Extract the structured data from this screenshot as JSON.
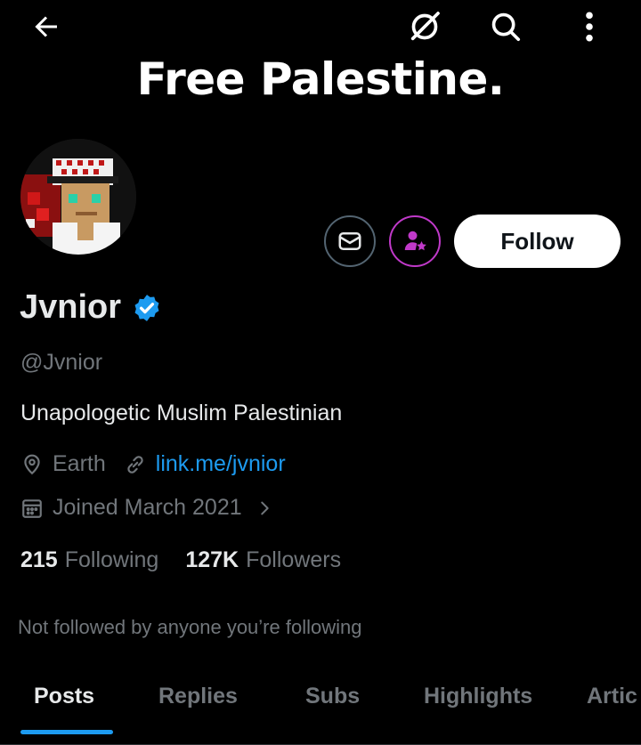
{
  "banner": {
    "text": "Free Palestine."
  },
  "actions": {
    "follow_label": "Follow"
  },
  "profile": {
    "name": "Jvnior",
    "handle": "@Jvnior",
    "bio": "Unapologetic Muslim Palestinian",
    "location": "Earth",
    "link": "link.me/jvnior",
    "joined": "Joined March 2021"
  },
  "stats": {
    "following_count": "215",
    "following_label": "Following",
    "followers_count": "127K",
    "followers_label": "Followers"
  },
  "social_context": "Not followed by anyone you’re following",
  "tabs": [
    {
      "label": "Posts",
      "active": true
    },
    {
      "label": "Replies"
    },
    {
      "label": "Subs"
    },
    {
      "label": "Highlights"
    },
    {
      "label": "Artic"
    }
  ],
  "colors": {
    "accent": "#1d9bf0",
    "subscribe": "#c039c9",
    "muted": "#71767b",
    "background": "#000000"
  }
}
